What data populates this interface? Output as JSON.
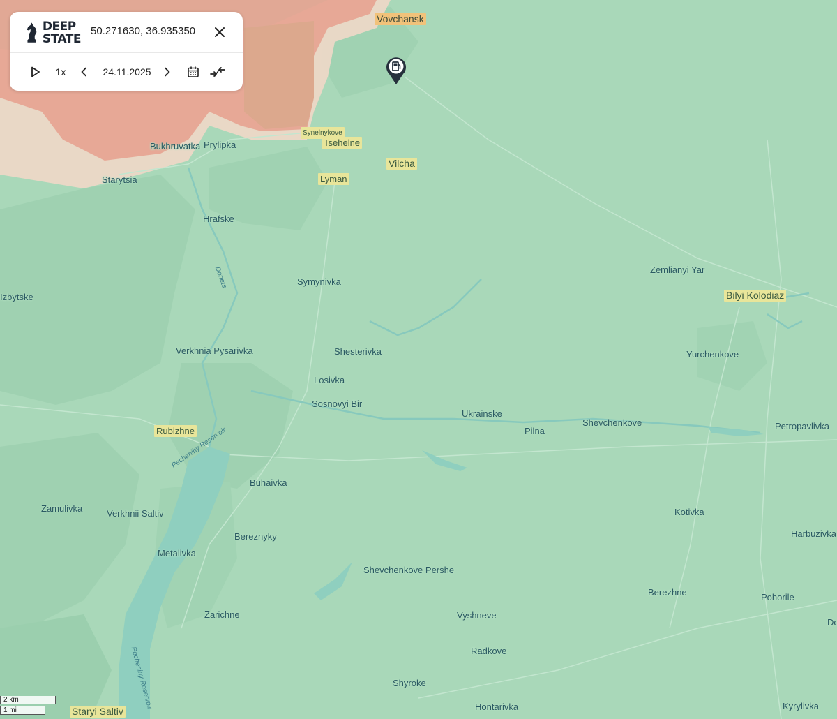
{
  "panel": {
    "logo_line1": "DEEP",
    "logo_line2": "STATE",
    "coordinates": "50.271630, 36.935350",
    "speed": "1x",
    "date": "24.11.2025"
  },
  "icons": {
    "close": "close-icon",
    "play": "play-icon",
    "prev": "chevron-left-icon",
    "next": "chevron-right-icon",
    "calendar": "calendar-icon",
    "collapse": "collapse-icon",
    "marker": "fuel-station-marker-icon"
  },
  "colors": {
    "liberated": "#a9d8b9",
    "occupied": "#e6a491",
    "contested": "#f0d8c8",
    "river": "#8fcfbf",
    "label_highlight": "#e8e59a"
  },
  "map": {
    "places": [
      {
        "name": "Vovchansk"
      },
      {
        "name": "Synelnykove"
      },
      {
        "name": "Tsehelne"
      },
      {
        "name": "Bukhruvatka"
      },
      {
        "name": "Prylipka"
      },
      {
        "name": "Vilcha"
      },
      {
        "name": "Starytsia"
      },
      {
        "name": "Lyman"
      },
      {
        "name": "Hrafske"
      },
      {
        "name": "Zemlianyi Yar"
      },
      {
        "name": "Bilyi Kolodiaz"
      },
      {
        "name": "Symynivka"
      },
      {
        "name": "Izbytske"
      },
      {
        "name": "Shesterivka"
      },
      {
        "name": "Verkhnia Pysarivka"
      },
      {
        "name": "Yurchenkove"
      },
      {
        "name": "Losivka"
      },
      {
        "name": "Sosnovyi Bir"
      },
      {
        "name": "Ukrainske"
      },
      {
        "name": "Pilna"
      },
      {
        "name": "Shevchenkove"
      },
      {
        "name": "Petropavlivka"
      },
      {
        "name": "Rubizhne"
      },
      {
        "name": "Buhaivka"
      },
      {
        "name": "Zamulivka"
      },
      {
        "name": "Verkhnii Saltiv"
      },
      {
        "name": "Kotivka"
      },
      {
        "name": "Bereznyky"
      },
      {
        "name": "Harbuzivka"
      },
      {
        "name": "Metalivka"
      },
      {
        "name": "Shevchenkove Pershe"
      },
      {
        "name": "Berezhne"
      },
      {
        "name": "Pohorile"
      },
      {
        "name": "Zarichne"
      },
      {
        "name": "Vyshneve"
      },
      {
        "name": "Do"
      },
      {
        "name": "Radkove"
      },
      {
        "name": "Shyroke"
      },
      {
        "name": "Staryi Saltiv"
      },
      {
        "name": "Hontarivka"
      },
      {
        "name": "Kyrylivka"
      }
    ],
    "rivers": [
      {
        "name": "Donets"
      },
      {
        "name": "Pechenihy Reservoir"
      },
      {
        "name": "Pechenihy Reservoir"
      }
    ],
    "scale": {
      "km": "2 km",
      "mi": "1 mi"
    }
  }
}
